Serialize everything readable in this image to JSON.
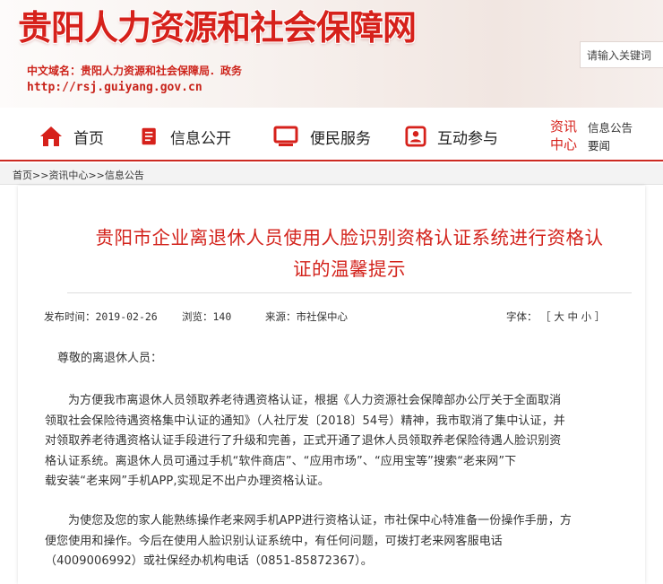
{
  "header": {
    "site_title": "贵阳人力资源和社会保障网",
    "domain_line": "中文域名：贵阳人力资源和社会保障局．政务",
    "url": "http://rsj.guiyang.gov.cn",
    "search_placeholder": "请输入关键词"
  },
  "nav": {
    "items": [
      {
        "label": "首页",
        "icon": "home-icon"
      },
      {
        "label": "信息公开",
        "icon": "document-icon"
      },
      {
        "label": "便民服务",
        "icon": "monitor-icon"
      },
      {
        "label": "互动参与",
        "icon": "contact-card-icon"
      }
    ],
    "news_center": {
      "line1": "资讯",
      "line2": "中心"
    },
    "news_links": [
      "信息公告",
      "要闻"
    ]
  },
  "breadcrumb": {
    "items": [
      "首页",
      "资讯中心",
      "信息公告"
    ],
    "separator": ">>"
  },
  "article": {
    "title_line1": "贵阳市企业离退休人员使用人脸识别资格认证系统进行资格认",
    "title_line2": "证的温馨提示",
    "meta": {
      "publish_label": "发布时间：",
      "publish_date": "2019-02-26",
      "views_label": "浏览：",
      "views": "140",
      "source_label": "来源：",
      "source": "市社保中心",
      "font_label": "字体：",
      "font_open": "［",
      "font_large": "大",
      "font_medium": "中",
      "font_small": "小",
      "font_close": "］"
    },
    "greeting": "尊敬的离退休人员：",
    "paragraph1": [
      "为方便我市离退休人员领取养老待遇资格认证，根据《人力资源社会保障部办公厅关于全面取消",
      "领取社会保险待遇资格集中认证的通知》（人社厅发〔2018〕54号）精神，我市取消了集中认证，并",
      "对领取养老待遇资格认证手段进行了升级和完善，正式开通了退休人员领取养老保险待遇人脸识别资",
      "格认证系统。离退休人员可通过手机“软件商店”、“应用市场”、“应用宝等”搜索“老来网”下",
      "载安装“老来网”手机APP,实现足不出户办理资格认证。"
    ],
    "paragraph2": [
      "为使您及您的家人能熟练操作老来网手机APP进行资格认证，市社保中心特准备一份操作手册，方",
      "便您使用和操作。今后在使用人脸识别认证系统中，有任何问题，可拨打老来网客服电话",
      "（4009006992）或社保经办机构电话（0851-85872367）。"
    ]
  },
  "colors": {
    "brand_red": "#d6211b",
    "nav_underline": "#cc2a22"
  }
}
